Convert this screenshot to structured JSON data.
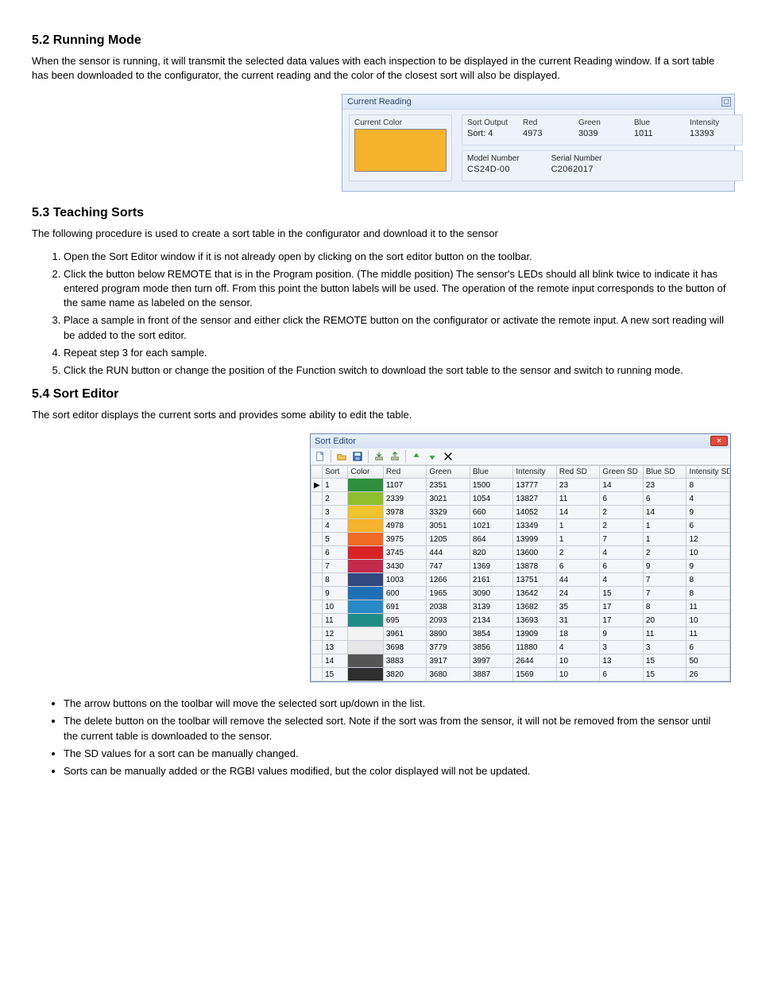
{
  "doc": {
    "h_running": "5.2 Running Mode",
    "p_running": "When the sensor is running, it will transmit the selected data values with each inspection to be displayed in the current Reading window. If a sort table has been downloaded to the configurator, the current reading and the color of the closest sort will also be displayed.",
    "h_teaching": "5.3 Teaching Sorts",
    "p_teaching": "The following procedure is used to create a sort table in the configurator and download it to the sensor",
    "steps": [
      "Open the Sort Editor window if it is not already open by clicking on the sort editor button on the toolbar.",
      "Click the button below REMOTE that is in the Program position. (The middle position) The sensor's LEDs should all blink twice to indicate it has entered program mode then turn off. From this point the button labels will be used. The operation of the remote input corresponds to the button of the same name as labeled on the sensor.",
      "Place a sample in front of the sensor and either click the REMOTE button on the configurator or activate the remote input. A new sort reading will be added to the sort editor.",
      "Repeat step 3 for each sample.",
      "Click the RUN button or change the position of the Function switch to download the sort table to the sensor and switch to running mode."
    ],
    "h_editor": "5.4 Sort Editor",
    "p_editor": "The sort editor displays the current sorts and provides some ability to edit the table.",
    "bullets": [
      "The arrow buttons on the toolbar will move the selected sort up/down in the list.",
      "The delete button on the toolbar will remove the selected sort. Note if the sort was from the sensor, it will not be removed from the sensor until the current table is downloaded to the sensor.",
      "The SD values for a sort can be manually changed.",
      "Sorts can be manually added or the RGBI values modified, but the color displayed will not be updated."
    ]
  },
  "current_reading": {
    "panel_title": "Current Reading",
    "group_label": "Current Color",
    "swatch_color": "#f5b32e",
    "fields": {
      "sort_output": {
        "label": "Sort Output",
        "value": "Sort: 4"
      },
      "red": {
        "label": "Red",
        "value": "4973"
      },
      "green": {
        "label": "Green",
        "value": "3039"
      },
      "blue": {
        "label": "Blue",
        "value": "1011"
      },
      "intensity": {
        "label": "Intensity",
        "value": "13393"
      },
      "model": {
        "label": "Model Number",
        "value": "CS24D-00"
      },
      "serial": {
        "label": "Serial Number",
        "value": "C2062017"
      }
    }
  },
  "sort_editor": {
    "title": "Sort Editor",
    "columns": [
      "Sort",
      "Color",
      "Red",
      "Green",
      "Blue",
      "Intensity",
      "Red SD",
      "Green SD",
      "Blue SD",
      "Intensity SD"
    ],
    "rows": [
      {
        "sort": 1,
        "color": "#2f8f3e",
        "red": 1107,
        "green": 2351,
        "blue": 1500,
        "int": 13777,
        "rsd": 23,
        "gsd": 14,
        "bsd": 23,
        "isd": 8
      },
      {
        "sort": 2,
        "color": "#8fbf2e",
        "red": 2339,
        "green": 3021,
        "blue": 1054,
        "int": 13827,
        "rsd": 11,
        "gsd": 6,
        "bsd": 6,
        "isd": 4
      },
      {
        "sort": 3,
        "color": "#f0c22e",
        "red": 3978,
        "green": 3329,
        "blue": 660,
        "int": 14052,
        "rsd": 14,
        "gsd": 2,
        "bsd": 14,
        "isd": 9
      },
      {
        "sort": 4,
        "color": "#f5b32e",
        "red": 4978,
        "green": 3051,
        "blue": 1021,
        "int": 13349,
        "rsd": 1,
        "gsd": 2,
        "bsd": 1,
        "isd": 6
      },
      {
        "sort": 5,
        "color": "#ef6a25",
        "red": 3975,
        "green": 1205,
        "blue": 864,
        "int": 13999,
        "rsd": 1,
        "gsd": 7,
        "bsd": 1,
        "isd": 12
      },
      {
        "sort": 6,
        "color": "#da2324",
        "red": 3745,
        "green": 444,
        "blue": 820,
        "int": 13600,
        "rsd": 2,
        "gsd": 4,
        "bsd": 2,
        "isd": 10
      },
      {
        "sort": 7,
        "color": "#c12a4a",
        "red": 3430,
        "green": 747,
        "blue": 1369,
        "int": 13878,
        "rsd": 6,
        "gsd": 6,
        "bsd": 9,
        "isd": 9
      },
      {
        "sort": 8,
        "color": "#32487f",
        "red": 1003,
        "green": 1266,
        "blue": 2161,
        "int": 13751,
        "rsd": 44,
        "gsd": 4,
        "bsd": 7,
        "isd": 8
      },
      {
        "sort": 9,
        "color": "#1f6fb5",
        "red": 600,
        "green": 1965,
        "blue": 3090,
        "int": 13642,
        "rsd": 24,
        "gsd": 15,
        "bsd": 7,
        "isd": 8
      },
      {
        "sort": 10,
        "color": "#2a8ac8",
        "red": 691,
        "green": 2038,
        "blue": 3139,
        "int": 13682,
        "rsd": 35,
        "gsd": 17,
        "bsd": 8,
        "isd": 11
      },
      {
        "sort": 11,
        "color": "#1f8d86",
        "red": 695,
        "green": 2093,
        "blue": 2134,
        "int": 13693,
        "rsd": 31,
        "gsd": 17,
        "bsd": 20,
        "isd": 10
      },
      {
        "sort": 12,
        "color": "#f4f4f4",
        "red": 3961,
        "green": 3890,
        "blue": 3854,
        "int": 13909,
        "rsd": 18,
        "gsd": 9,
        "bsd": 11,
        "isd": 11
      },
      {
        "sort": 13,
        "color": "#e6e6e6",
        "red": 3698,
        "green": 3779,
        "blue": 3856,
        "int": 11880,
        "rsd": 4,
        "gsd": 3,
        "bsd": 3,
        "isd": 6
      },
      {
        "sort": 14,
        "color": "#555555",
        "red": 3883,
        "green": 3917,
        "blue": 3997,
        "int": 2644,
        "rsd": 10,
        "gsd": 13,
        "bsd": 15,
        "isd": 50
      },
      {
        "sort": 15,
        "color": "#2e2e2e",
        "red": 3820,
        "green": 3680,
        "blue": 3887,
        "int": 1569,
        "rsd": 10,
        "gsd": 6,
        "bsd": 15,
        "isd": 26
      }
    ]
  },
  "chart_data": {
    "type": "table",
    "title": "Sort Editor",
    "columns": [
      "Sort",
      "Red",
      "Green",
      "Blue",
      "Intensity",
      "Red SD",
      "Green SD",
      "Blue SD",
      "Intensity SD"
    ],
    "rows": [
      [
        1,
        1107,
        2351,
        1500,
        13777,
        23,
        14,
        23,
        8
      ],
      [
        2,
        2339,
        3021,
        1054,
        13827,
        11,
        6,
        6,
        4
      ],
      [
        3,
        3978,
        3329,
        660,
        14052,
        14,
        2,
        14,
        9
      ],
      [
        4,
        4978,
        3051,
        1021,
        13349,
        1,
        2,
        1,
        6
      ],
      [
        5,
        3975,
        1205,
        864,
        13999,
        1,
        7,
        1,
        12
      ],
      [
        6,
        3745,
        444,
        820,
        13600,
        2,
        4,
        2,
        10
      ],
      [
        7,
        3430,
        747,
        1369,
        13878,
        6,
        6,
        9,
        9
      ],
      [
        8,
        1003,
        1266,
        2161,
        13751,
        44,
        4,
        7,
        8
      ],
      [
        9,
        600,
        1965,
        3090,
        13642,
        24,
        15,
        7,
        8
      ],
      [
        10,
        691,
        2038,
        3139,
        13682,
        35,
        17,
        8,
        11
      ],
      [
        11,
        695,
        2093,
        2134,
        13693,
        31,
        17,
        20,
        10
      ],
      [
        12,
        3961,
        3890,
        3854,
        13909,
        18,
        9,
        11,
        11
      ],
      [
        13,
        3698,
        3779,
        3856,
        11880,
        4,
        3,
        3,
        6
      ],
      [
        14,
        3883,
        3917,
        3997,
        2644,
        10,
        13,
        15,
        50
      ],
      [
        15,
        3820,
        3680,
        3887,
        1569,
        10,
        6,
        15,
        26
      ]
    ]
  }
}
